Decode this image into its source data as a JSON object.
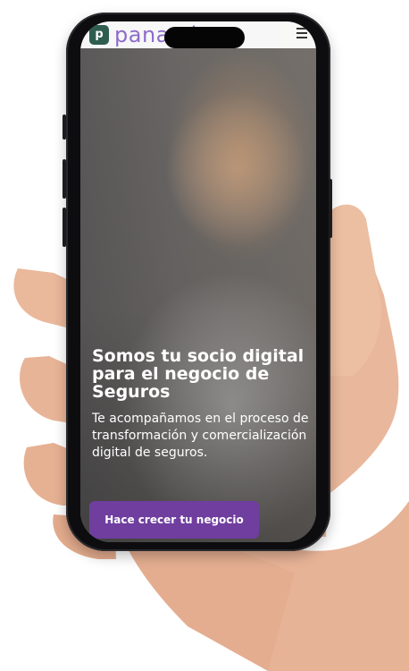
{
  "brand": {
    "name": "panamb",
    "mark": "p"
  },
  "hero": {
    "headline": "Somos tu socio digital para el negocio de Seguros",
    "subtitle": "Te acompañamos en el proceso de transformación y comercialización digital de seguros.",
    "cta_label": "Hace crecer tu negocio"
  },
  "colors": {
    "brand_purple": "#8d6cc9",
    "cta_purple": "#6f3e9f",
    "logo_green": "#2e5d4f"
  },
  "icons": {
    "menu": "hamburger-menu-icon"
  }
}
